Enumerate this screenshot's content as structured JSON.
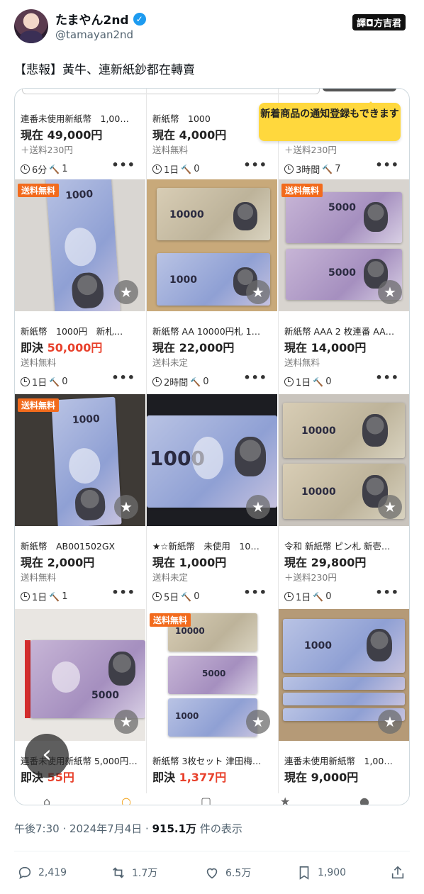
{
  "author": {
    "name": "たまやん2nd",
    "handle": "@tamayan2nd",
    "watermark": "譯◘方吉君"
  },
  "tweet": {
    "text": "【悲報】黃牛、連新紙鈔都在轉賣"
  },
  "tooltip": "新着商品の通知登録もできます",
  "listings": [
    {
      "title": "連番未使用新紙幣　1,00…",
      "price_label": "現在",
      "price": "49,000円",
      "shipping": "＋送料230円",
      "time": "6分",
      "bids": "1",
      "badge": "",
      "price_red": false
    },
    {
      "title": "新紙幣　1000",
      "price_label": "現在",
      "price": "4,000円",
      "shipping": "送料無料",
      "time": "1日",
      "bids": "0",
      "badge": "",
      "price_red": false
    },
    {
      "title": "",
      "price_label": "",
      "price": "",
      "shipping": "＋送料230円",
      "time": "3時間",
      "bids": "7",
      "badge": "",
      "price_red": false
    },
    {
      "title": "新紙幣　1000円　新札…",
      "price_label": "即決",
      "price": "50,000円",
      "shipping": "送料無料",
      "time": "1日",
      "bids": "0",
      "badge": "送料無料",
      "price_red": true
    },
    {
      "title": "新紙幣 AA 10000円札 1…",
      "price_label": "現在",
      "price": "22,000円",
      "shipping": "送料未定",
      "time": "2時間",
      "bids": "0",
      "badge": "",
      "price_red": false
    },
    {
      "title": "新紙幣 AAA 2 枚連番 AA…",
      "price_label": "現在",
      "price": "14,000円",
      "shipping": "送料無料",
      "time": "1日",
      "bids": "0",
      "badge": "送料無料",
      "price_red": false
    },
    {
      "title": "新紙幣　AB001502GX",
      "price_label": "現在",
      "price": "2,000円",
      "shipping": "送料無料",
      "time": "1日",
      "bids": "1",
      "badge": "送料無料",
      "price_red": false
    },
    {
      "title": "★☆新紙幣　未使用　10…",
      "price_label": "現在",
      "price": "1,000円",
      "shipping": "送料未定",
      "time": "5日",
      "bids": "0",
      "badge": "",
      "price_red": false
    },
    {
      "title": "令和 新紙幣 ピン札 新壱…",
      "price_label": "現在",
      "price": "29,800円",
      "shipping": "＋送料230円",
      "time": "1日",
      "bids": "0",
      "badge": "",
      "price_red": false
    },
    {
      "title": "連番未使用新紙幣 5,000円…",
      "price_label": "即決",
      "price": "55円",
      "shipping": "",
      "time": "",
      "bids": "",
      "badge": "",
      "price_red": true
    },
    {
      "title": "新紙幣 3枚セット 津田梅…",
      "price_label": "即決",
      "price": "1,377円",
      "shipping": "",
      "time": "",
      "bids": "",
      "badge": "送料無料",
      "price_red": true
    },
    {
      "title": "連番未使用新紙幣　1,00…",
      "price_label": "現在",
      "price": "9,000円",
      "shipping": "",
      "time": "",
      "bids": "",
      "badge": "",
      "price_red": false
    }
  ],
  "notes": {
    "d1000": "1000",
    "d5000": "5000",
    "d10000": "10000"
  },
  "footer": {
    "time": "午後7:30",
    "date": "2024年7月4日",
    "views": "915.1万",
    "views_label": "件の表示"
  },
  "actions": {
    "replies": "2,419",
    "reposts": "1.7万",
    "likes": "6.5万",
    "bookmarks": "1,900"
  },
  "colors": {
    "accent": "#1d9bf0",
    "badge": "#f26b1d",
    "price_red": "#e8412c",
    "tooltip": "#ffd83d"
  }
}
